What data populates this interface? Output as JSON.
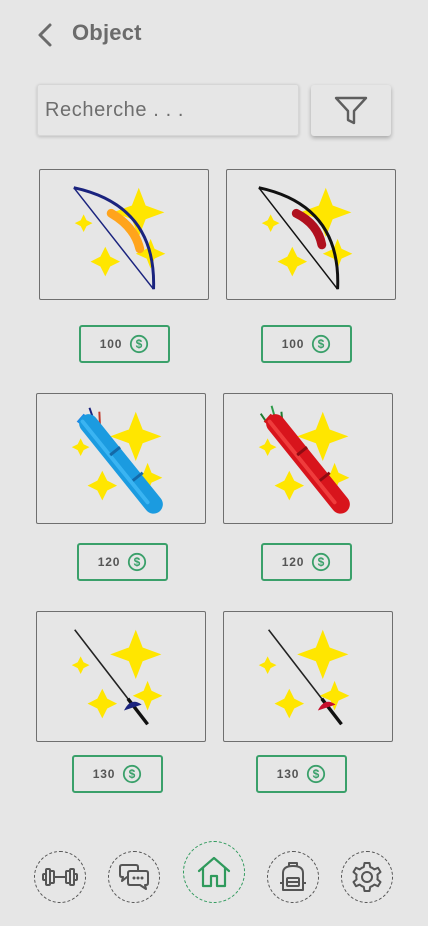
{
  "header": {
    "title": "Object"
  },
  "search": {
    "placeholder": "Recherche . . ."
  },
  "items": [
    {
      "name": "bow-orange",
      "price": "100"
    },
    {
      "name": "bow-red",
      "price": "100"
    },
    {
      "name": "quiver-blue",
      "price": "120"
    },
    {
      "name": "quiver-red",
      "price": "120"
    },
    {
      "name": "fencing-sword-blue",
      "price": "130"
    },
    {
      "name": "fencing-sword-red",
      "price": "130"
    }
  ],
  "colors": {
    "accent_green": "#3aa06a",
    "sparkle_yellow": "#ffe600",
    "background": "#e6e6e6"
  },
  "nav": [
    "dumbbell-icon",
    "chat-icon",
    "home-icon",
    "backpack-icon",
    "gear-icon"
  ]
}
